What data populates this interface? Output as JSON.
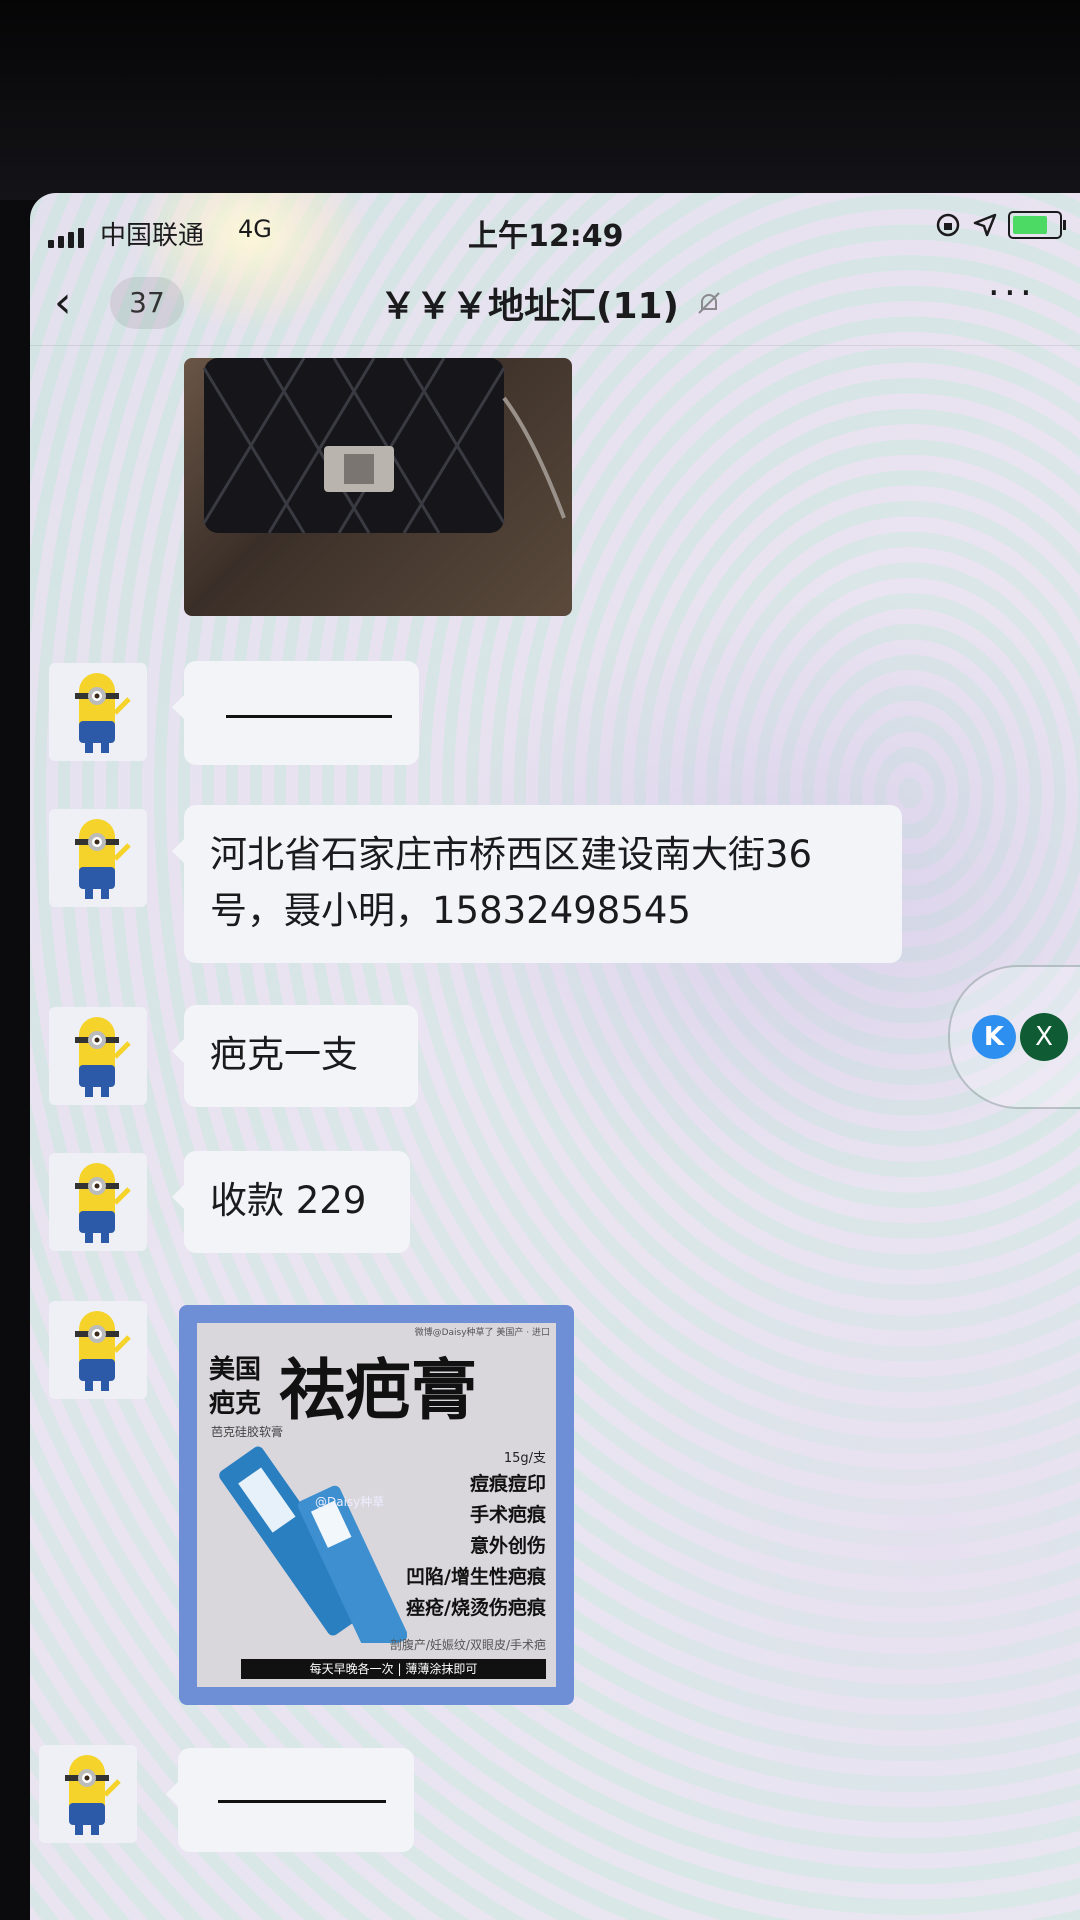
{
  "status_bar": {
    "carrier": "中国联通",
    "network": "4G",
    "time": "上午12:49",
    "battery_color": "#4cd964"
  },
  "nav": {
    "back_icon": "chevron-left-icon",
    "unread_count": "37",
    "title": "￥￥￥地址汇(11)",
    "mute_icon": "bell-slash-icon",
    "more_label": "···"
  },
  "messages": [
    {
      "type": "image",
      "desc": "black quilted bag photo"
    },
    {
      "type": "text",
      "text": ""
    },
    {
      "type": "text",
      "text": "河北省石家庄市桥西区建设南大街36号，聂小明，15832498545"
    },
    {
      "type": "text",
      "text": "疤克一支"
    },
    {
      "type": "text",
      "text": "收款 229"
    },
    {
      "type": "image",
      "poster": {
        "top_note": "微博@Daisy种草了  美国产 · 进口",
        "brand_line1": "美国",
        "brand_line2": "疤克",
        "headline": "祛疤膏",
        "sub": "芭克硅胶软膏",
        "size": "15g/支",
        "benefits": [
          "痘痕痘印",
          "手术疤痕",
          "意外创伤",
          "凹陷/增生性疤痕",
          "痤疮/烧烫伤疤痕"
        ],
        "small": "剖腹产/妊娠纹/双眼皮/手术疤",
        "bottom": "每天早晚各一次 | 薄薄涂抹即可",
        "watermark": "@Daisy种草",
        "accent": "#2a7fc0"
      }
    },
    {
      "type": "text",
      "text": ""
    }
  ],
  "floater": {
    "k_label": "K",
    "x_label": "X"
  }
}
